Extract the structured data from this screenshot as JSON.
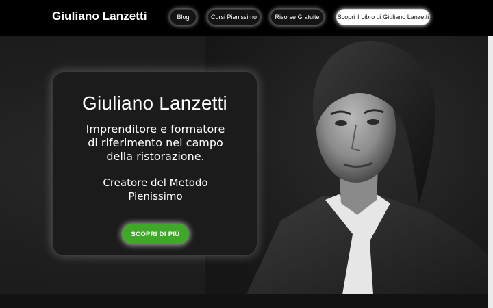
{
  "header": {
    "brand": "Giuliano Lanzetti",
    "nav": [
      {
        "label": "Blog"
      },
      {
        "label": "Corsi Pienissimo"
      },
      {
        "label": "Risorse Gratuite"
      },
      {
        "label": "Scopri il Libro di Giuliano Lanzetti"
      }
    ]
  },
  "hero": {
    "title": "Giuliano Lanzetti",
    "subtitle": "Imprenditore e formatore di riferimento nel campo della ristorazione.",
    "tagline": "Creatore del Metodo Pienissimo",
    "cta_label": "SCOPRI DI PIÙ",
    "portrait_icon": "portrait-photo"
  },
  "colors": {
    "header_bg": "#000000",
    "hero_bg": "#1e1e1e",
    "cta_green": "#3fa829",
    "text": "#ffffff"
  }
}
